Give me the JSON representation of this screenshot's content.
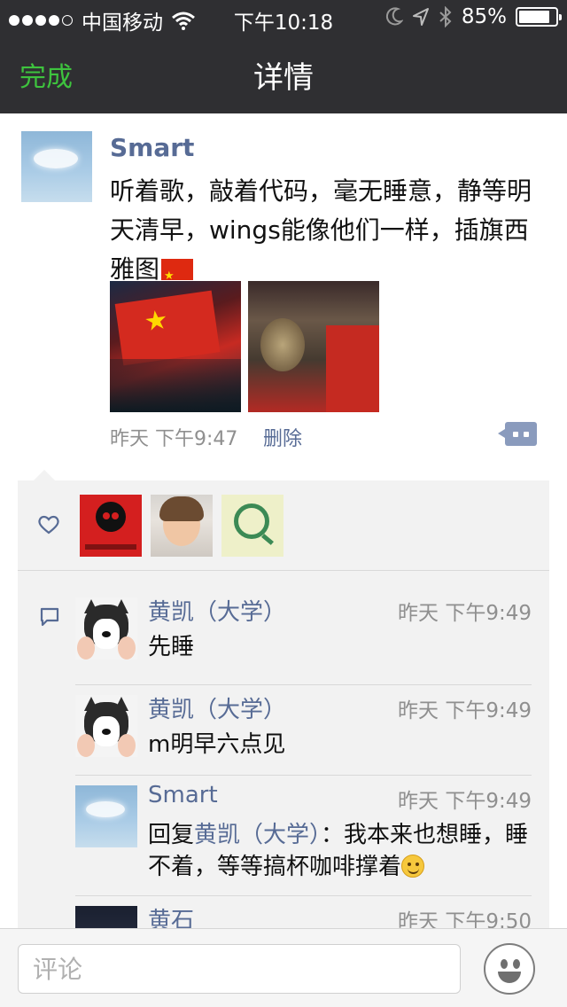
{
  "status_bar": {
    "carrier": "中国移动",
    "time": "下午10:18",
    "battery_text": "85%",
    "battery_level": 0.85,
    "icons": [
      "signal-dots-icon",
      "wifi-icon",
      "moon-icon",
      "location-arrow-icon",
      "bluetooth-icon",
      "battery-icon"
    ]
  },
  "nav": {
    "done_label": "完成",
    "title": "详情"
  },
  "post": {
    "author": "Smart",
    "text": "听着歌，敲着代码，毫无睡意，静等明天清早，wings能像他们一样，插旗西雅图",
    "time": "昨天 下午9:47",
    "delete_label": "删除"
  },
  "comments": [
    {
      "name": "黄凯（大学）",
      "time": "昨天 下午9:49",
      "text": "先睡"
    },
    {
      "name": "黄凯（大学）",
      "time": "昨天 下午9:49",
      "text": "m明早六点见"
    },
    {
      "name": "Smart",
      "time": "昨天 下午9:49",
      "reply_prefix": "回复",
      "reply_to": "黄凯（大学）",
      "text": "：我本来也想睡，睡不着，等等搞杯咖啡撑着"
    },
    {
      "name": "黄石",
      "time": "昨天 下午9:50",
      "text": ""
    }
  ],
  "input": {
    "placeholder": "评论"
  },
  "colors": {
    "nav_bg": "#2f2f32",
    "accent_green": "#3ec33e",
    "link_blue": "#576b95",
    "panel_bg": "#f2f2f2"
  }
}
